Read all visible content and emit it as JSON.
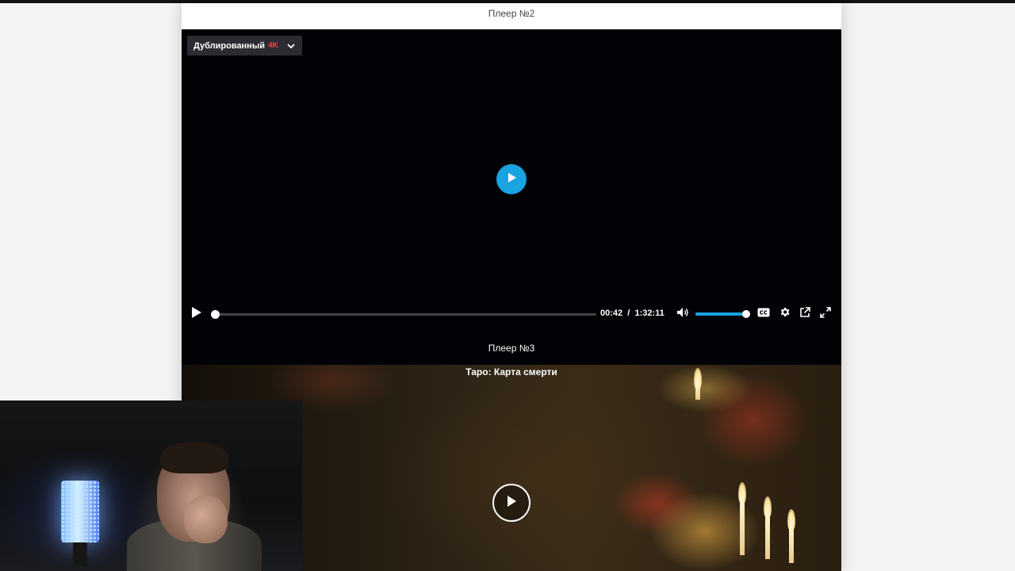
{
  "player2": {
    "title": "Плеер №2",
    "translation": {
      "label": "Дублированный",
      "quality": "4K",
      "icon": "chevron-down-icon"
    },
    "controls": {
      "current_time": "00:42",
      "separator": "/",
      "duration": "1:32:11",
      "progress_fraction": 0.008,
      "volume_fraction": 1.0
    },
    "icons": [
      "play-icon",
      "volume-icon",
      "subtitles-icon",
      "gear-icon",
      "popout-icon",
      "fullscreen-icon"
    ]
  },
  "player3": {
    "title": "Плеер №3",
    "movie_title": "Таро: Карта смерти"
  },
  "colors": {
    "accent": "#19a3e0",
    "quality_badge": "#ff3b3b",
    "player_bg": "#010205",
    "page_bg": "#f3f3f3"
  }
}
